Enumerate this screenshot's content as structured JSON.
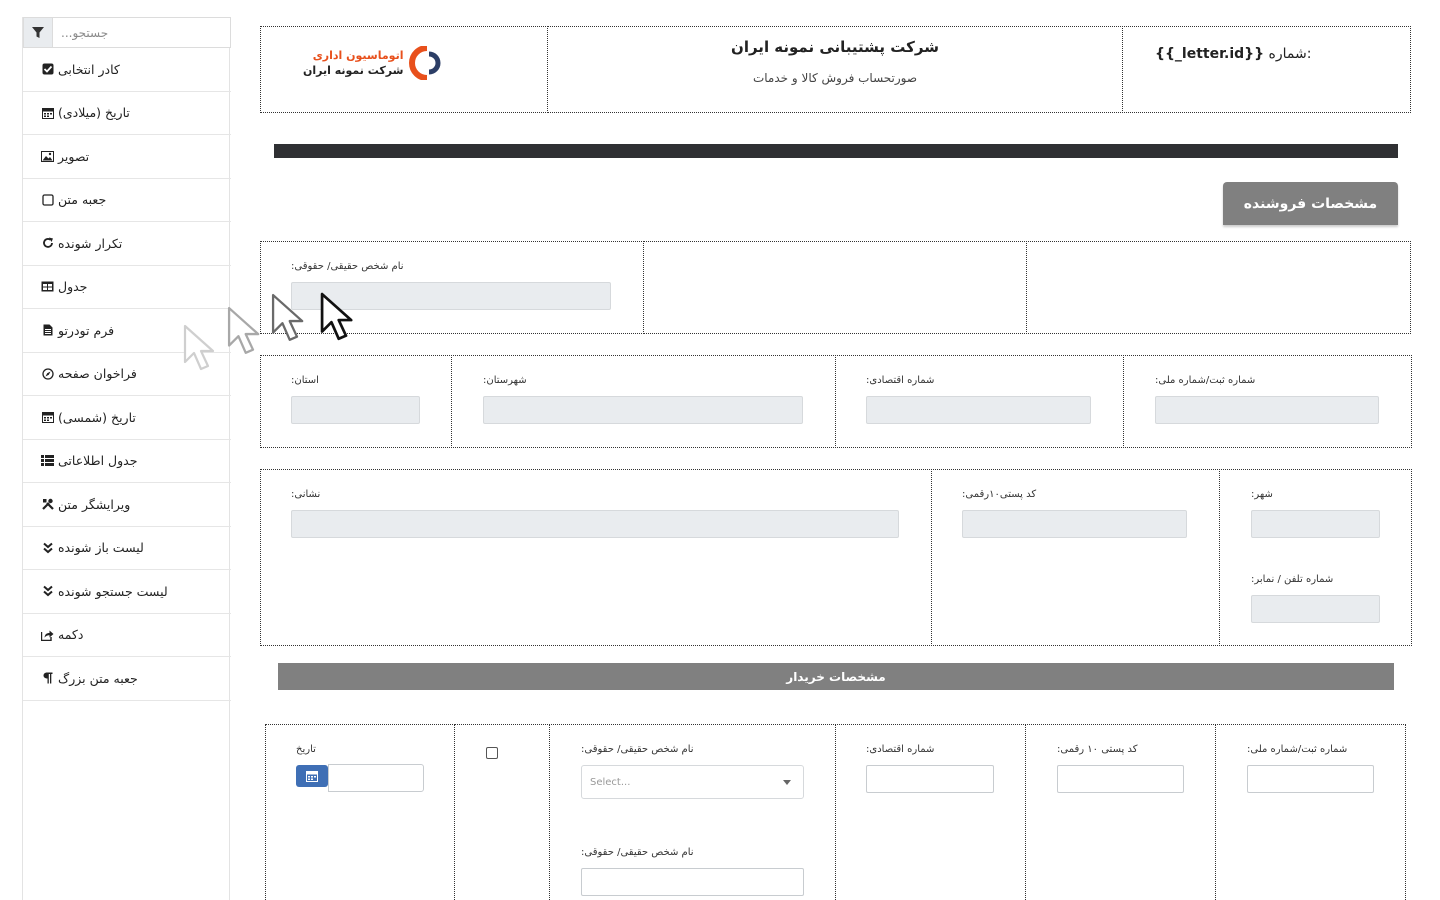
{
  "toolbox": {
    "search_placeholder": "جستجو...",
    "items": [
      {
        "label": "کادر انتخابی",
        "icon": "checkbox-checked-icon"
      },
      {
        "label": "تاریخ (میلادی)",
        "icon": "calendar-icon"
      },
      {
        "label": "تصویر",
        "icon": "image-icon"
      },
      {
        "label": "جعبه متن",
        "icon": "square-icon"
      },
      {
        "label": "تکرار شونده",
        "icon": "refresh-icon"
      },
      {
        "label": "جدول",
        "icon": "table-icon"
      },
      {
        "label": "فرم تودرتو",
        "icon": "file-icon"
      },
      {
        "label": "فراخوان صفحه",
        "icon": "compass-icon"
      },
      {
        "label": "تاریخ (شمسی)",
        "icon": "calendar-icon"
      },
      {
        "label": "جدول اطلاعاتی",
        "icon": "list-icon"
      },
      {
        "label": "ویرایشگر متن",
        "icon": "tools-icon"
      },
      {
        "label": "لیست باز شونده",
        "icon": "double-chevron-down-icon"
      },
      {
        "label": "لیست جستجو شونده",
        "icon": "double-chevron-down-icon"
      },
      {
        "label": "دکمه",
        "icon": "share-icon"
      },
      {
        "label": "جعبه متن بزرگ",
        "icon": "paragraph-icon"
      }
    ]
  },
  "header": {
    "number_label": "شماره:",
    "number_value": "{{_letter.id}}",
    "company_title": "شرکت پشتیبانی نمونه ایران",
    "subtitle": "صورتحساب فروش کالا و خدمات",
    "logo_line1": "اتوماسیون اداری",
    "logo_line2": "شرکت نمونه ایران"
  },
  "seller": {
    "tab_label": "مشخصات فروشنده",
    "name_label": ":نام شخص حقیقی/ حقوقی",
    "province_label": ":استان",
    "county_label": ":شهرستان",
    "economic_label": ":شماره اقتصادی",
    "reg_label": ":شماره ثبت/شماره ملی",
    "address_label": ":نشانی",
    "postal_label": ":کد پستی۱۰رقمی",
    "city_label": ":شهر",
    "phone_label": ":شماره تلفن / نمابر"
  },
  "buyer": {
    "bar_label": "مشخصات خریدار",
    "date_label": "تاریخ",
    "name_label": ":نام شخص حقیقی/ حقوقی",
    "select_placeholder": "Select...",
    "name2_label": ":نام شخص حقیقی/ حقوقی",
    "economic_label": ":شماره اقتصادی",
    "postal_label": ":کد پستی ۱۰ رقمی",
    "reg_label": ":شماره ثبت/شماره ملی"
  },
  "colors": {
    "accent_blue": "#3f6fb5",
    "section_gray": "#808080",
    "dark_bar": "#2f3033",
    "logo_orange": "#e8501c"
  }
}
